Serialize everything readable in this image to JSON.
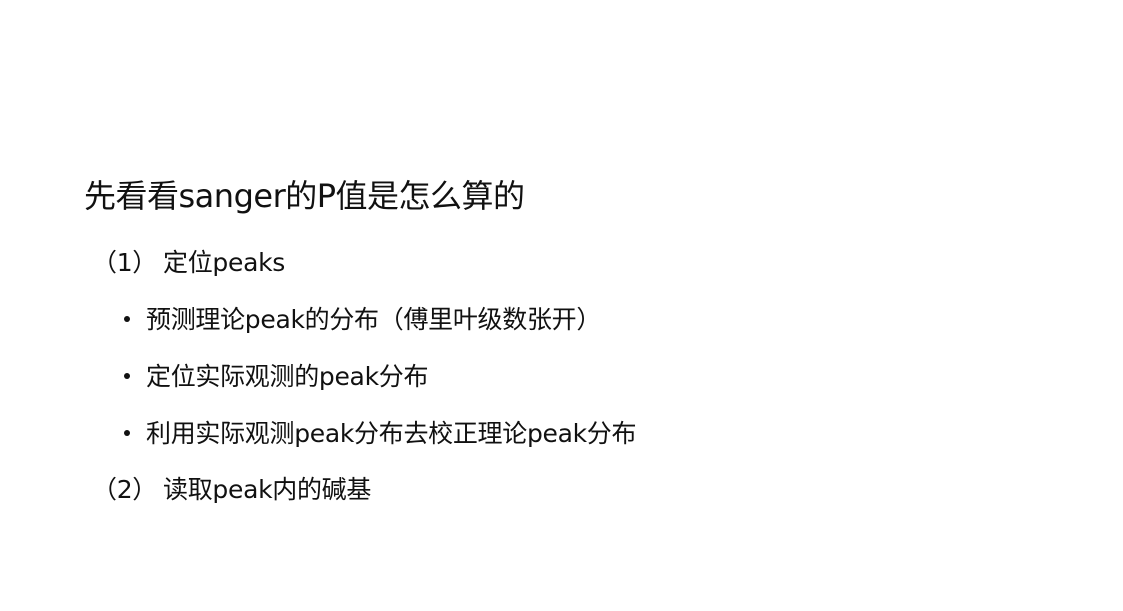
{
  "slide": {
    "title": "先看看sanger的P值是怎么算的",
    "sections": [
      {
        "number": "（1）",
        "text": "定位peaks",
        "bullets": [
          "预测理论peak的分布（傅里叶级数张开）",
          "定位实际观测的peak分布",
          "利用实际观测peak分布去校正理论peak分布"
        ]
      },
      {
        "number": "（2）",
        "text": "读取peak内的碱基"
      }
    ]
  }
}
